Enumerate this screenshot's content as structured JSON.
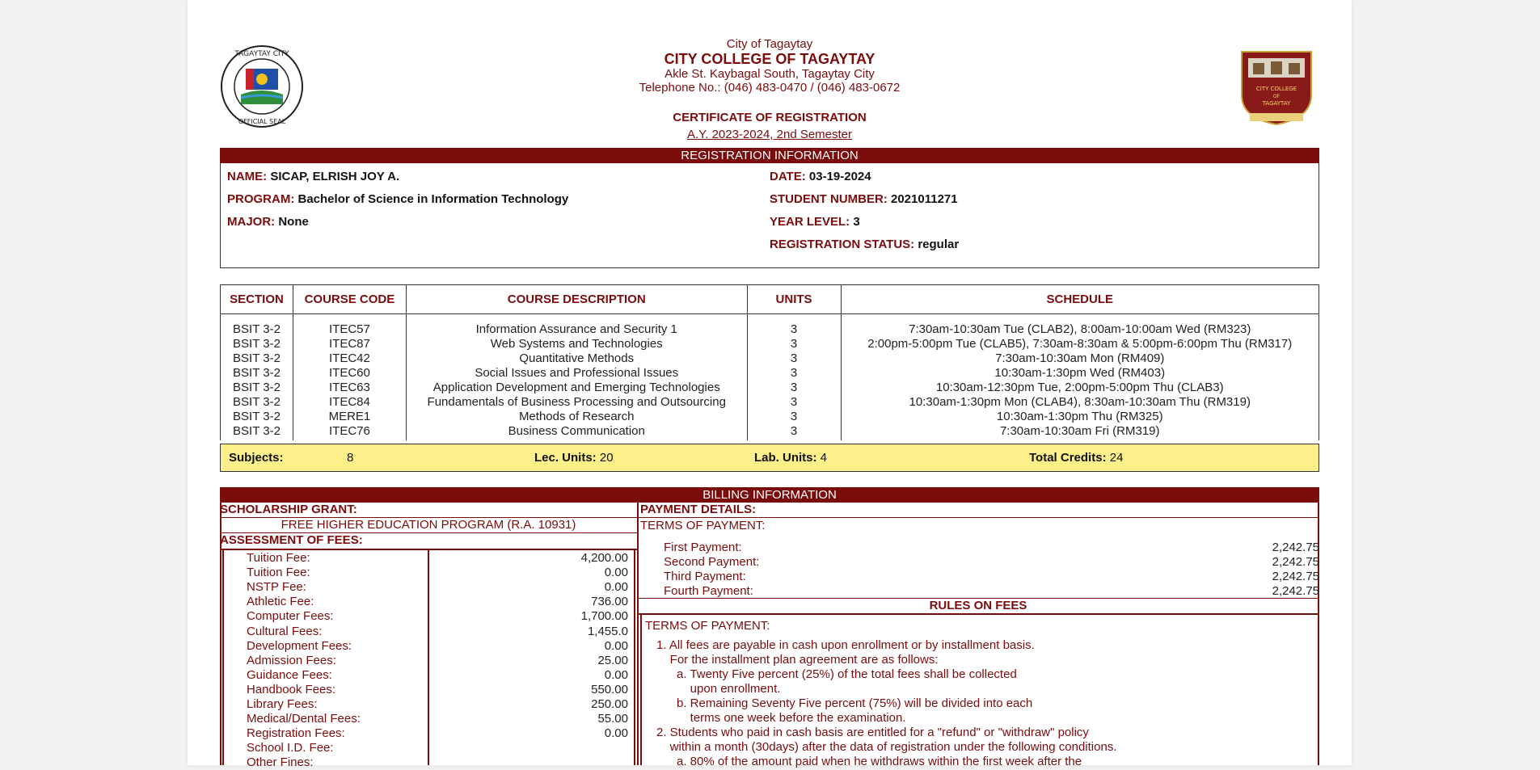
{
  "header": {
    "city": "City of Tagaytay",
    "college": "CITY COLLEGE OF TAGAYTAY",
    "address": "Akle St. Kaybagal South, Tagaytay City",
    "telephone": "Telephone No.: (046) 483-0470 / (046) 483-0672",
    "certificate": "CERTIFICATE OF REGISTRATION",
    "academic_year": "A.Y. 2023-2024, 2nd Semester",
    "left_seal_text": "TAGAYTAY CITY · OFFICIAL SEAL",
    "right_seal_text": "CITY COLLEGE OF TAGAYTAY"
  },
  "registration": {
    "title": "REGISTRATION INFORMATION",
    "name_label": "NAME:",
    "name": "SICAP, ELRISH JOY A.",
    "program_label": "PROGRAM:",
    "program": "Bachelor of Science in Information Technology",
    "major_label": "MAJOR:",
    "major": "None",
    "date_label": "DATE:",
    "date": "03-19-2024",
    "student_number_label": "STUDENT NUMBER:",
    "student_number": "2021011271",
    "year_level_label": "YEAR LEVEL:",
    "year_level": "3",
    "status_label": "REGISTRATION STATUS:",
    "status": "regular"
  },
  "courses": {
    "headers": [
      "SECTION",
      "COURSE CODE",
      "COURSE DESCRIPTION",
      "UNITS",
      "SCHEDULE"
    ],
    "rows": [
      {
        "section": "BSIT 3-2",
        "code": "ITEC57",
        "description": "Information Assurance and Security 1",
        "units": "3",
        "schedule": "7:30am-10:30am Tue (CLAB2), 8:00am-10:00am Wed (RM323)"
      },
      {
        "section": "BSIT 3-2",
        "code": "ITEC87",
        "description": "Web Systems and Technologies",
        "units": "3",
        "schedule": "2:00pm-5:00pm Tue (CLAB5), 7:30am-8:30am & 5:00pm-6:00pm Thu (RM317)"
      },
      {
        "section": "BSIT 3-2",
        "code": "ITEC42",
        "description": "Quantitative Methods",
        "units": "3",
        "schedule": "7:30am-10:30am Mon (RM409)"
      },
      {
        "section": "BSIT 3-2",
        "code": "ITEC60",
        "description": "Social Issues and Professional Issues",
        "units": "3",
        "schedule": "10:30am-1:30pm Wed (RM403)"
      },
      {
        "section": "BSIT 3-2",
        "code": "ITEC63",
        "description": "Application Development and Emerging Technologies",
        "units": "3",
        "schedule": "10:30am-12:30pm Tue, 2:00pm-5:00pm Thu (CLAB3)"
      },
      {
        "section": "BSIT 3-2",
        "code": "ITEC84",
        "description": "Fundamentals of Business Processing and Outsourcing",
        "units": "3",
        "schedule": "10:30am-1:30pm Mon (CLAB4), 8:30am-10:30am Thu (RM319)"
      },
      {
        "section": "BSIT 3-2",
        "code": "MERE1",
        "description": "Methods of Research",
        "units": "3",
        "schedule": "10:30am-1:30pm Thu (RM325)"
      },
      {
        "section": "BSIT 3-2",
        "code": "ITEC76",
        "description": "Business Communication",
        "units": "3",
        "schedule": "7:30am-10:30am Fri (RM319)"
      }
    ]
  },
  "summary": {
    "subjects_label": "Subjects:",
    "subjects": "8",
    "lec_label": "Lec. Units:",
    "lec": "20",
    "lab_label": "Lab. Units:",
    "lab": "4",
    "credits_label": "Total Credits:",
    "credits": "24"
  },
  "billing": {
    "title": "BILLING INFORMATION",
    "scholarship_label": "SCHOLARSHIP GRANT:",
    "scholarship": "FREE HIGHER EDUCATION PROGRAM (R.A. 10931)",
    "assessment_label": "ASSESSMENT OF FEES:",
    "fees": [
      {
        "label": "Tuition Fee:",
        "value": "4,200.00"
      },
      {
        "label": "Tuition Fee:",
        "value": "0.00"
      },
      {
        "label": "NSTP Fee:",
        "value": "0.00"
      },
      {
        "label": "Athletic Fee:",
        "value": "736.00"
      },
      {
        "label": "Computer Fees:",
        "value": "1,700.00"
      },
      {
        "label": "Cultural Fees:",
        "value": "1,455.0"
      },
      {
        "label": "Development Fees:",
        "value": "0.00"
      },
      {
        "label": "Admission Fees:",
        "value": "25.00"
      },
      {
        "label": "Guidance Fees:",
        "value": "0.00"
      },
      {
        "label": "Handbook Fees:",
        "value": "550.00"
      },
      {
        "label": "Library Fees:",
        "value": "250.00"
      },
      {
        "label": "Medical/Dental Fees:",
        "value": "55.00"
      },
      {
        "label": "Registration Fees:",
        "value": "0.00"
      },
      {
        "label": "School I.D. Fee:",
        "value": ""
      },
      {
        "label": "Other Fines:",
        "value": ""
      }
    ],
    "payment_label": "PAYMENT DETAILS:",
    "terms_label": "TERMS OF PAYMENT:",
    "payments": [
      {
        "label": "First Payment:",
        "value": "2,242.75"
      },
      {
        "label": "Second Payment:",
        "value": "2,242.75"
      },
      {
        "label": "Third Payment:",
        "value": "2,242.75"
      },
      {
        "label": "Fourth Payment:",
        "value": "2,242.75"
      }
    ],
    "rules_title": "RULES ON FEES",
    "rules_terms": "TERMS OF PAYMENT:",
    "rules_lines": [
      "1. All fees are payable in cash upon enrollment or by installment basis.",
      "    For the installment plan agreement are as follows:",
      "      a. Twenty Five percent (25%) of the total fees shall be collected",
      "          upon enrollment.",
      "      b. Remaining Seventy Five percent (75%) will be divided into each",
      "          terms one week before the examination.",
      "2. Students who paid in cash basis are entitled for a \"refund\" or \"withdraw\" policy",
      "    within a month (30days) after the data of registration under the following conditions.",
      "      a. 80% of the amount paid when he withdraws within the first week after the"
    ]
  }
}
